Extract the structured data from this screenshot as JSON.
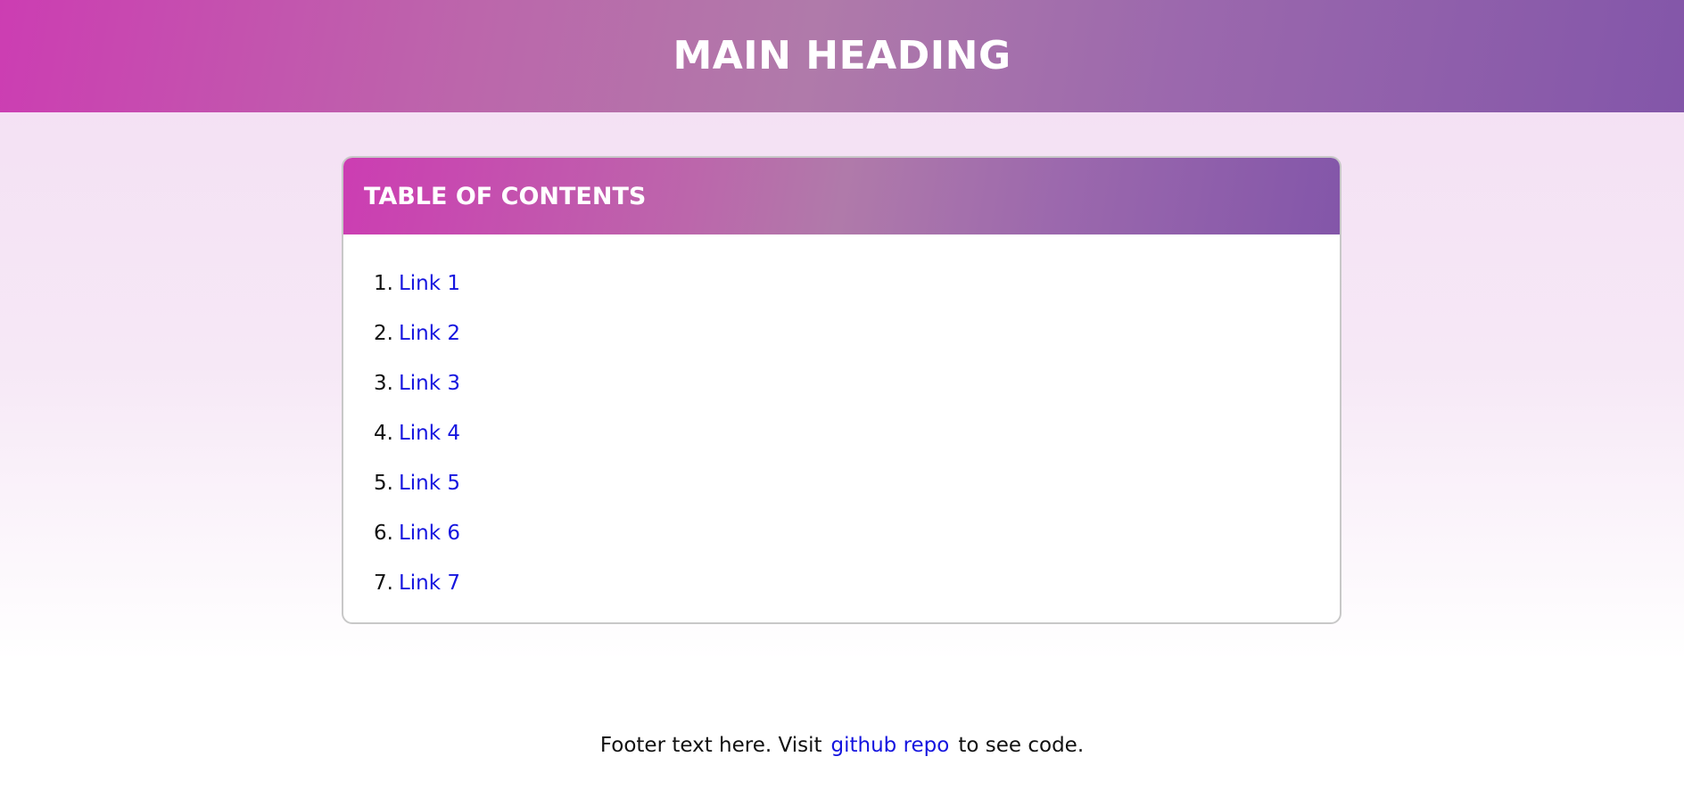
{
  "header": {
    "title": "MAIN HEADING"
  },
  "toc": {
    "title": "TABLE OF CONTENTS",
    "items": [
      {
        "number": "1.",
        "label": "Link 1"
      },
      {
        "number": "2.",
        "label": "Link 2"
      },
      {
        "number": "3.",
        "label": "Link 3"
      },
      {
        "number": "4.",
        "label": "Link 4"
      },
      {
        "number": "5.",
        "label": "Link 5"
      },
      {
        "number": "6.",
        "label": "Link 6"
      },
      {
        "number": "7.",
        "label": "Link 7"
      }
    ]
  },
  "footer": {
    "text_before": "Footer text here. Visit",
    "link_label": "github repo",
    "text_after": "to see code."
  },
  "colors": {
    "gradient_start": "#cc3db2",
    "gradient_mid": "#b07aaa",
    "gradient_end": "#8356a9",
    "link": "#1515df",
    "card_border": "#c8c8c8"
  }
}
